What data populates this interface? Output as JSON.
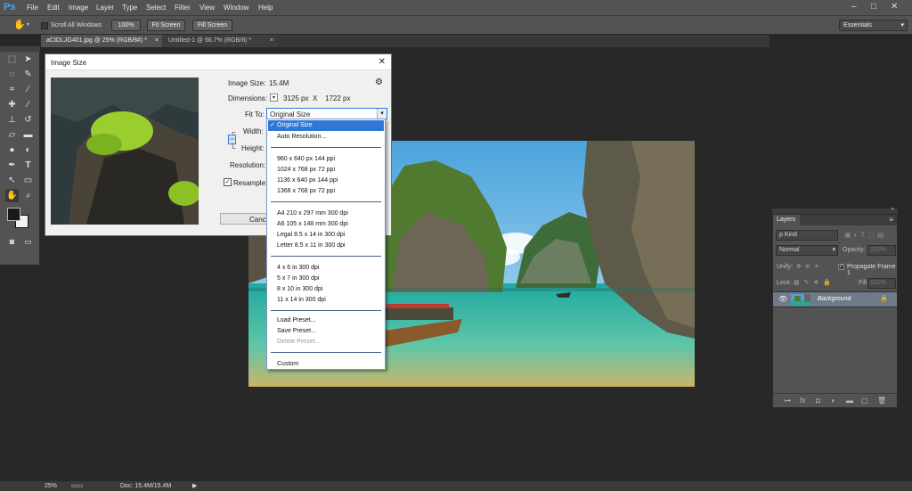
{
  "app": {
    "logo": "Ps"
  },
  "menu": [
    "File",
    "Edit",
    "Image",
    "Layer",
    "Type",
    "Select",
    "Filter",
    "View",
    "Window",
    "Help"
  ],
  "window_buttons": [
    "–",
    "□",
    "✕"
  ],
  "options_bar": {
    "scroll_all_windows": "Scroll All Windows",
    "btn_100": "100%",
    "btn_fit": "Fit Screen",
    "btn_fill": "Fill Screen",
    "workspace": "Essentials"
  },
  "tabs": [
    {
      "label": "aCtDLJG401.jpg @ 25% (RGB/8#) *",
      "close": "×"
    },
    {
      "label": "Untitled-1 @ 66.7% (RGB/8) *",
      "close": "×"
    }
  ],
  "tool_icons": [
    "marquee-icon",
    "move-icon",
    "lasso-icon",
    "quick-select-icon",
    "crop-icon",
    "eyedropper-icon",
    "healing-icon",
    "brush-icon",
    "stamp-icon",
    "history-brush-icon",
    "eraser-icon",
    "gradient-icon",
    "blur-icon",
    "dodge-icon",
    "pen-icon",
    "type-icon",
    "path-select-icon",
    "shape-icon",
    "hand-icon",
    "zoom-icon"
  ],
  "dialog": {
    "title": "Image Size",
    "close": "✕",
    "image_size_label": "Image Size:",
    "image_size_value": "15.4M",
    "dimensions_label": "Dimensions:",
    "dimensions_w": "3125 px",
    "dimensions_x": "X",
    "dimensions_h": "1722 px",
    "fit_to_label": "Fit To:",
    "fit_to_value": "Original Size",
    "width_label": "Width:",
    "height_label": "Height:",
    "resolution_label": "Resolution:",
    "resample_label": "Resample:",
    "cancel_label": "Cancel"
  },
  "dropdown": {
    "selected": "Original Size",
    "groups": [
      [
        "Auto Resolution..."
      ],
      [
        "960 x 640 px 144 ppi",
        "1024 x 768 px 72 ppi",
        "1136 x 640 px 144 ppi",
        "1366 x 768 px 72 ppi"
      ],
      [
        "A4 210 x 297 mm 300 dpi",
        "A6 105 x 148 mm 300 dpi",
        "Legal 8.5 x 14 in 300 dpi",
        "Letter 8.5 x 11 in 300 dpi"
      ],
      [
        "4 x 6 in 300 dpi",
        "5 x 7 in 300 dpi",
        "8 x 10 in 300 dpi",
        "11 x 14 in 300 dpi"
      ],
      [
        "Load Preset...",
        "Save Preset...",
        "Delete Preset..."
      ],
      [
        "Custom"
      ]
    ]
  },
  "layers_panel": {
    "title": "Layers",
    "kind": "ρ Kind",
    "blend_mode": "Normal",
    "opacity_label": "Opacity:",
    "opacity_value": "100%",
    "unify_label": "Unify:",
    "propagate_label": "Propagate Frame 1",
    "lock_label": "Lock:",
    "fill_label": "Fill:",
    "fill_value": "100%",
    "layer_name": "Background",
    "footer_icons": [
      "link-icon",
      "fx-icon",
      "mask-icon",
      "adjustment-icon",
      "folder-icon",
      "new-layer-icon",
      "trash-icon"
    ]
  },
  "status": {
    "zoom": "25%",
    "doc": "Doc: 15.4M/15.4M"
  },
  "colors": {
    "accent": "#4fa3e8",
    "highlight": "#3178d6",
    "panel": "#535353",
    "canvas": "#282828"
  }
}
